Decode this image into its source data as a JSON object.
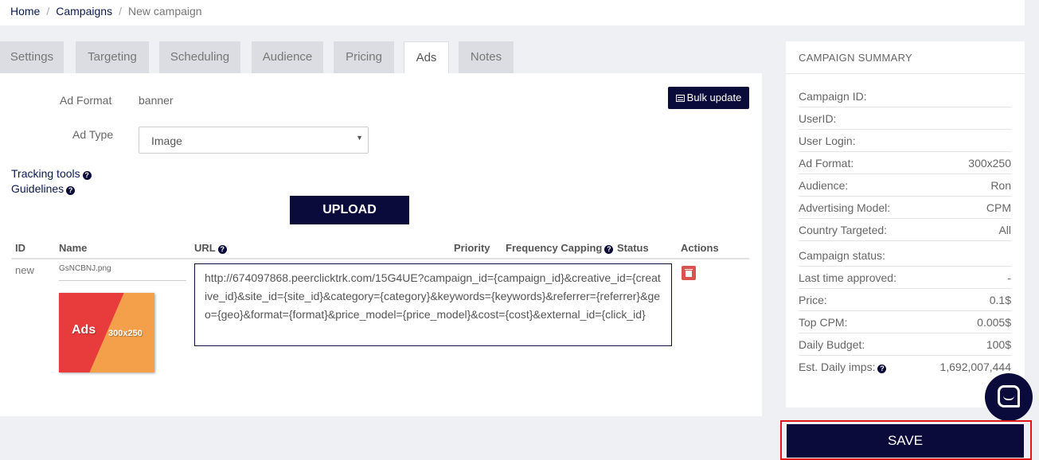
{
  "breadcrumb": {
    "home": "Home",
    "separator": "/",
    "campaigns": "Campaigns",
    "current": "New campaign"
  },
  "tabs": [
    "Settings",
    "Targeting",
    "Scheduling",
    "Audience",
    "Pricing",
    "Ads",
    "Notes"
  ],
  "active_tab": "Ads",
  "form": {
    "ad_format_label": "Ad Format",
    "ad_format_value": "banner",
    "ad_type_label": "Ad Type",
    "ad_type_value": "Image",
    "bulk_update_label": "Bulk update",
    "tracking_tools_label": "Tracking tools",
    "guidelines_label": "Guidelines",
    "upload_label": "UPLOAD"
  },
  "table": {
    "headers": {
      "id": "ID",
      "name": "Name",
      "url": "URL",
      "priority": "Priority",
      "frequency_capping": "Frequency Capping",
      "status": "Status",
      "actions": "Actions"
    },
    "rows": [
      {
        "id": "new",
        "name": "GsNCBNJ.png",
        "thumb_text": "Ads",
        "thumb_size": "300x250",
        "url": "http://674097868.peerclicktrk.com/15G4UE?campaign_id={campaign_id}&creative_id={creative_id}&site_id={site_id}&category={category}&keywords={keywords}&referrer={referrer}&geo={geo}&format={format}&price_model={price_model}&cost={cost}&external_id={click_id}"
      }
    ]
  },
  "summary": {
    "title": "CAMPAIGN SUMMARY",
    "rows": [
      {
        "k": "Campaign ID:",
        "v": ""
      },
      {
        "k": "UserID:",
        "v": ""
      },
      {
        "k": "User Login:",
        "v": ""
      },
      {
        "k": "Ad Format:",
        "v": "300x250"
      },
      {
        "k": "Audience:",
        "v": "Ron"
      },
      {
        "k": "Advertising Model:",
        "v": "CPM"
      },
      {
        "k": "Country Targeted:",
        "v": "All"
      },
      {
        "k": "Campaign status:",
        "v": ""
      },
      {
        "k": "Last time approved:",
        "v": "-"
      },
      {
        "k": "Price:",
        "v": "0.1$"
      },
      {
        "k": "Top CPM:",
        "v": "0.005$"
      },
      {
        "k": "Daily Budget:",
        "v": "100$"
      },
      {
        "k": "Est. Daily imps:",
        "v": "1,692,007,444"
      }
    ]
  },
  "save_label": "SAVE",
  "colors": {
    "primary": "#0b0b3b",
    "link": "#0b1a4e",
    "danger": "#d9534f",
    "highlight": "#e01818",
    "background": "#eff0f4",
    "tab_inactive": "#dcdde2"
  },
  "icons": {
    "help": "question-circle-icon",
    "bulk": "list-icon",
    "delete": "trash-icon",
    "chat": "chat-icon"
  }
}
